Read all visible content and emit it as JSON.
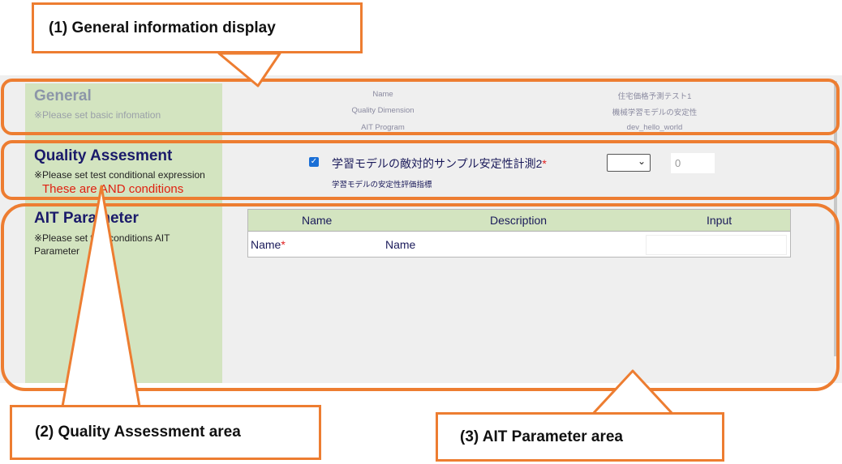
{
  "colors": {
    "accent_orange": "#ed7d31",
    "section_green": "#d3e4c0",
    "heading_navy": "#1a1a6a",
    "required_red": "#e02020"
  },
  "general": {
    "title": "General",
    "note": "※Please set basic infomation",
    "fields": [
      {
        "label": "Name",
        "value": "住宅価格予測テスト1"
      },
      {
        "label": "Quality Dimension",
        "value": "機械学習モデルの安定性"
      },
      {
        "label": "AIT Program",
        "value": "dev_hello_world"
      }
    ]
  },
  "quality": {
    "title": "Quality Assesment",
    "note": "※Please set test conditional expression",
    "and_note": "These are AND conditions",
    "item_label": "学習モデルの敵対的サンプル安定性計測2",
    "required_mark": "*",
    "item_sub": "学習モデルの安定性評価指標",
    "checked": true,
    "operator_value": "",
    "threshold_placeholder": "0"
  },
  "ait_param": {
    "title": "AIT Parameter",
    "note_line1": "※Please set test conditions AIT",
    "note_line2": "Parameter",
    "columns": [
      "Name",
      "Description",
      "Input"
    ],
    "rows": [
      {
        "name": "Name",
        "required": "*",
        "description": "Name",
        "input": ""
      }
    ]
  },
  "callouts": {
    "c1": "(1) General information display",
    "c2": "(2) Quality Assessment area",
    "c3": "(3) AIT Parameter area"
  }
}
